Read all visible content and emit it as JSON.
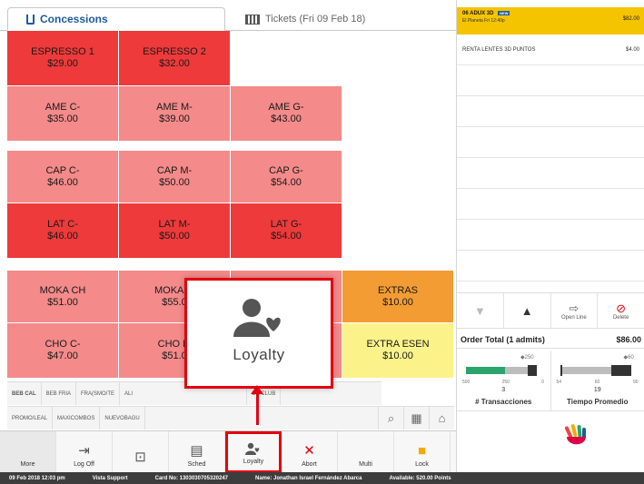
{
  "tabs": {
    "concessions": "Concessions",
    "tickets": "Tickets (Fri 09 Feb 18)"
  },
  "tiles": [
    {
      "name": "ESPRESSO 1",
      "price": "$29.00"
    },
    {
      "name": "ESPRESSO 2",
      "price": "$32.00"
    },
    {
      "name": "AME C-",
      "price": "$35.00"
    },
    {
      "name": "AME M-",
      "price": "$39.00"
    },
    {
      "name": "AME G-",
      "price": "$43.00"
    },
    {
      "name": "CAP C-",
      "price": "$46.00"
    },
    {
      "name": "CAP M-",
      "price": "$50.00"
    },
    {
      "name": "CAP G-",
      "price": "$54.00"
    },
    {
      "name": "LAT C-",
      "price": "$46.00"
    },
    {
      "name": "LAT M-",
      "price": "$50.00"
    },
    {
      "name": "LAT G-",
      "price": "$54.00"
    },
    {
      "name": "MOKA CH",
      "price": "$51.00"
    },
    {
      "name": "MOKA M",
      "price": "$55.0"
    },
    {
      "name": "EXTRAS",
      "price": "$10.00"
    },
    {
      "name": "CHO C-",
      "price": "$47.00"
    },
    {
      "name": "CHO M",
      "price": "$51.0"
    },
    {
      "name": "EXTRA ESEN",
      "price": "$10.00"
    }
  ],
  "categories_row1": [
    "BEB CAL",
    "BEB FRIA",
    "FRA(SMO/TE",
    "ALI",
    "GE/CLUB"
  ],
  "categories_row2": [
    "PROMO/LEAL",
    "MAXICOMBOS",
    "NUEVOBAGU"
  ],
  "toolbar": {
    "more": "More",
    "logoff": "Log Off",
    "sched": "Sched",
    "loyalty": "Loyalty",
    "abort": "Abort",
    "multi": "Multi",
    "lock": "Lock"
  },
  "popup": {
    "label": "Loyalty"
  },
  "order": {
    "title": "06 ADUX 3D",
    "badge": "NEW",
    "subtitle": "El Planeta Fri 12:40p",
    "price": "$82.00",
    "line1": "RENTA LENTES 3D PUNTOS",
    "line1_price": "$4.00"
  },
  "controls": {
    "open_line": "Open Line",
    "delete": "Delete"
  },
  "order_total": {
    "label": "Order Total (1 admits)",
    "value": "$86.00"
  },
  "metrics": {
    "transactions": {
      "label": "# Transacciones",
      "value": "3",
      "target": "250",
      "ticks": [
        "500",
        "250",
        "0"
      ],
      "fill_fraction": 0.55
    },
    "avg_time": {
      "label": "Tiempo Promedio",
      "value": "19",
      "target": "60",
      "ticks": [
        "54",
        "60",
        "90"
      ],
      "fill_fraction": 0.6
    }
  },
  "status": {
    "datetime": "09 Feb 2018 12:03 pm",
    "user": "Vista Support",
    "card": "Card No: 1303030705320247",
    "name": "Name: Jonathan Israel Fernández Abarca",
    "available": "Available: 520.00 Points"
  },
  "colors": {
    "red": "#ee3a3a",
    "salmon": "#f48a8a",
    "orange": "#f39c34",
    "yellow": "#fbf38a",
    "highlight": "#e3000f",
    "header": "#f5c400"
  }
}
